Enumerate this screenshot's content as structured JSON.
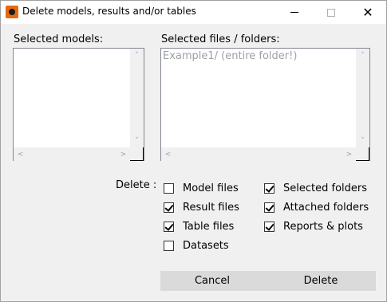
{
  "window": {
    "title": "Delete models, results and/or tables",
    "icon": "app-icon",
    "controls": {
      "minimize": "minimize-icon",
      "maximize": "maximize-icon",
      "close": "✕"
    }
  },
  "models_panel": {
    "label": "Selected models:",
    "items": []
  },
  "files_panel": {
    "label": "Selected files / folders:",
    "items": [
      "Example1/ (entire folder!)"
    ]
  },
  "scroll_arrows": {
    "up": "˄",
    "down": "˅",
    "left": "<",
    "right": ">"
  },
  "delete_options": {
    "label": "Delete :",
    "left_column": [
      {
        "label": "Model files",
        "checked": false
      },
      {
        "label": "Result files",
        "checked": true
      },
      {
        "label": "Table files",
        "checked": true
      },
      {
        "label": "Datasets",
        "checked": false
      }
    ],
    "right_column": [
      {
        "label": "Selected folders",
        "checked": true
      },
      {
        "label": "Attached folders",
        "checked": true
      },
      {
        "label": "Reports & plots",
        "checked": true
      }
    ]
  },
  "buttons": {
    "cancel": "Cancel",
    "delete": "Delete"
  },
  "colors": {
    "app_icon": "#e86a10",
    "button_bar": "#dadada",
    "placeholder_text": "#a0a0a0"
  }
}
